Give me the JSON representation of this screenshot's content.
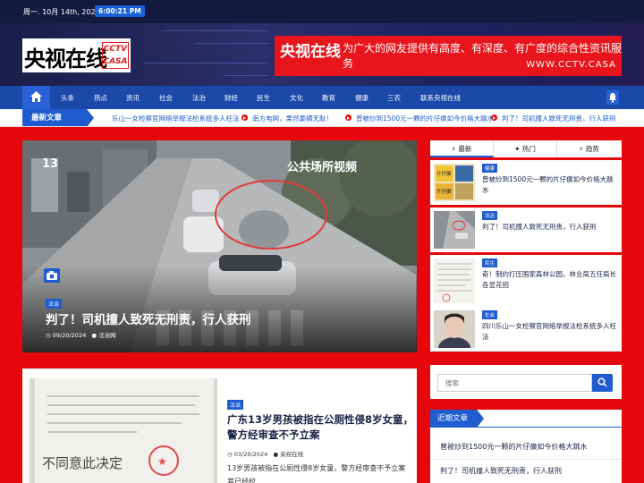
{
  "topbar": {
    "date": "周一. 10月 14th, 2024",
    "time": "6:00:21 PM"
  },
  "header": {
    "logo_cn": "央视在线",
    "logo_en": "CCTV CASA",
    "banner_brand": "央视在线",
    "banner_slogan": "为广大的网友提供有高度、有深度、有广度的综合性资讯服务",
    "banner_url": "WWW.CCTV.CASA"
  },
  "nav": {
    "items": [
      "头条",
      "热点",
      "资讯",
      "社会",
      "法治",
      "财经",
      "民生",
      "文化",
      "教育",
      "健康",
      "三农",
      "联系央视在线"
    ]
  },
  "ticker": {
    "label": "最新文章",
    "items": [
      "乐山一女检察官网络举报法检系统多人枉法",
      "南方电网，果然豪横无耻！",
      "曾被炒到1500元一颗的片仔癀如今价格大跳水",
      "判了！司机撞人致死无刑责，行人获刑"
    ]
  },
  "featured": {
    "category": "法治",
    "title": "判了！司机撞人致死无刑责，行人获刑",
    "date": "09/20/2024",
    "author": "法治网",
    "image_caption": "公共场所视频",
    "image_logo": "13"
  },
  "post": {
    "category": "法治",
    "title": "广东13岁男孩被指在公厕性侵8岁女童，警方经审查不予立案",
    "date": "03/20/2024",
    "author": "央视在线",
    "excerpt": "13岁男孩被指在公厕性侵8岁女童，警方经审查不予立案其已经校…",
    "image_text": "不同意此决定"
  },
  "sidebar": {
    "tabs": [
      "最新",
      "热门",
      "趋势"
    ],
    "items": [
      {
        "category": "健康",
        "title": "曾被炒到1500元一颗的片仔癀如今价格大跳水"
      },
      {
        "category": "法治",
        "title": "判了！司机撞人致死无刑责，行人获刑"
      },
      {
        "category": "民生",
        "title": "奇！制约打压国家森林公园，林业局五任局长各显花招"
      },
      {
        "category": "社会",
        "title": "四川乐山一女检察官网络举报法检系统多人枉法"
      }
    ],
    "thumb1_label_a": "片仔癀",
    "thumb1_label_b": "片仔癀",
    "search_placeholder": "搜索",
    "recent_label": "近期文章",
    "recent_items": [
      "曾被炒到1500元一颗的片仔癀如今价格大跳水",
      "判了！司机撞人致死无刑责，行人获刑"
    ]
  },
  "colors": {
    "page_bg": "#e6070d",
    "accent": "#1e5ccf",
    "topbar": "#131b3f",
    "nav": "#1a49aa"
  }
}
